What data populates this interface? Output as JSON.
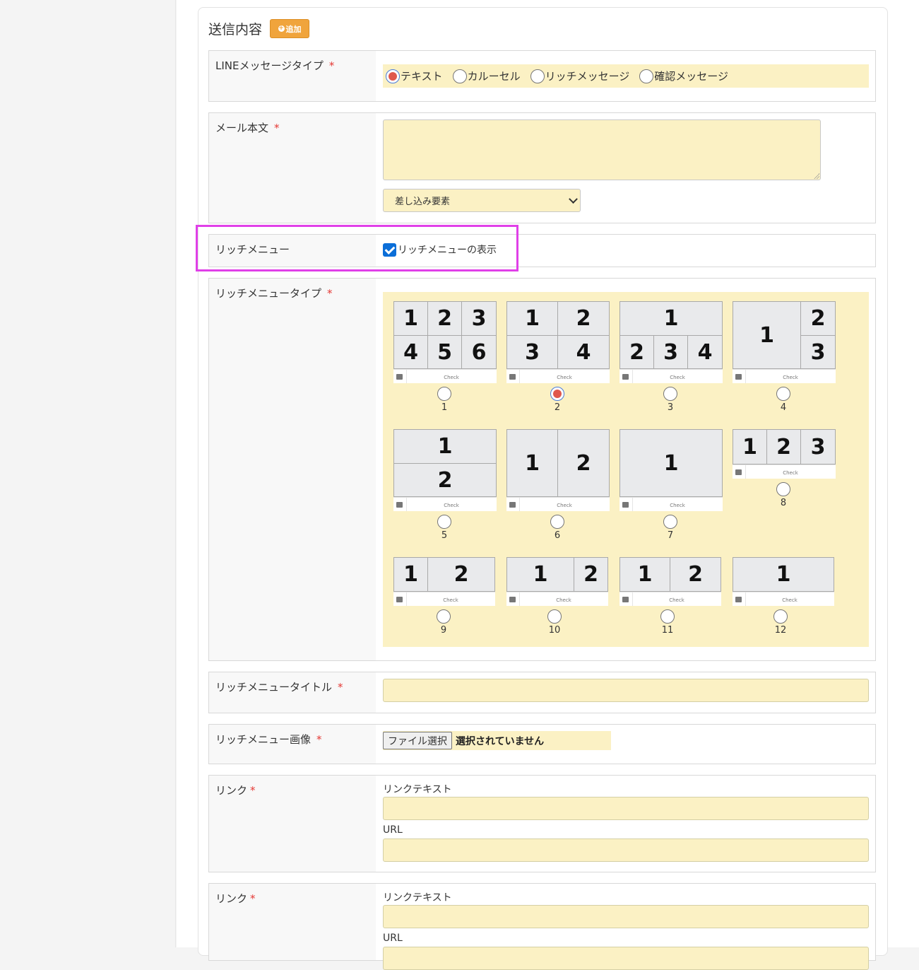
{
  "section": {
    "title": "送信内容",
    "add_label": "追加"
  },
  "line_message_type": {
    "label": "LINEメッセージタイプ",
    "required": "*",
    "options": [
      "テキスト",
      "カルーセル",
      "リッチメッセージ",
      "確認メッセージ"
    ],
    "selected": "テキスト"
  },
  "mail_body": {
    "label": "メール本文",
    "required": "*",
    "value": "",
    "insert_select": {
      "selected": "差し込み要素"
    }
  },
  "rich_menu": {
    "label": "リッチメニュー",
    "checkbox_label": "リッチメニューの表示",
    "checked": true
  },
  "rich_menu_type": {
    "label": "リッチメニュータイプ",
    "required": "*",
    "selected": "2",
    "bar_text": "Check",
    "options": [
      {
        "id": "1",
        "cells": [
          "1",
          "2",
          "3",
          "4",
          "5",
          "6"
        ]
      },
      {
        "id": "2",
        "cells": [
          "1",
          "2",
          "3",
          "4"
        ]
      },
      {
        "id": "3",
        "cells": [
          "1",
          "2",
          "3",
          "4"
        ]
      },
      {
        "id": "4",
        "cells": [
          "1",
          "2",
          "3"
        ]
      },
      {
        "id": "5",
        "cells": [
          "1",
          "2"
        ]
      },
      {
        "id": "6",
        "cells": [
          "1",
          "2"
        ]
      },
      {
        "id": "7",
        "cells": [
          "1"
        ]
      },
      {
        "id": "8",
        "cells": [
          "1",
          "2",
          "3"
        ]
      },
      {
        "id": "9",
        "cells": [
          "1",
          "2"
        ]
      },
      {
        "id": "10",
        "cells": [
          "1",
          "2"
        ]
      },
      {
        "id": "11",
        "cells": [
          "1",
          "2"
        ]
      },
      {
        "id": "12",
        "cells": [
          "1"
        ]
      }
    ]
  },
  "rich_menu_title": {
    "label": "リッチメニュータイトル",
    "required": "*",
    "value": ""
  },
  "rich_menu_image": {
    "label": "リッチメニュー画像",
    "required": "*",
    "button_label": "ファイル選択",
    "status": "選択されていません"
  },
  "links": [
    {
      "label": "リンク",
      "required": "*",
      "text_label": "リンクテキスト",
      "url_label": "URL",
      "text_value": "",
      "url_value": ""
    },
    {
      "label": "リンク",
      "required": "*",
      "text_label": "リンクテキスト",
      "url_label": "URL",
      "text_value": "",
      "url_value": ""
    }
  ]
}
